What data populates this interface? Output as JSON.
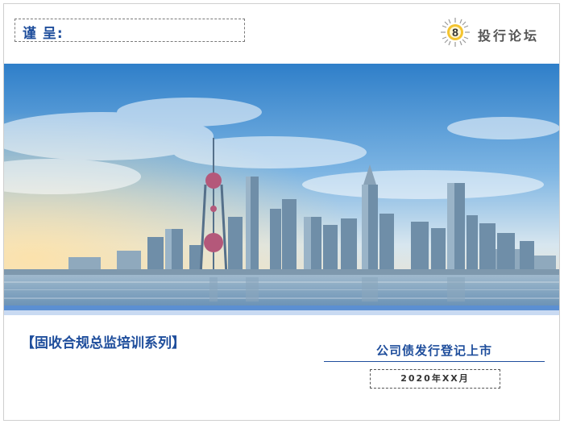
{
  "header": {
    "recipient_label": "谨 呈:",
    "logo_digit": "8",
    "logo_text": "投行论坛"
  },
  "hero": {
    "image_description_icon": "city-skyline-image"
  },
  "footer": {
    "series_title": "【固收合规总监培训系列】",
    "subtitle": "公司债发行登记上市",
    "date": "2020年XX月"
  },
  "colors": {
    "brand_blue": "#1f4e9c",
    "accent_blue": "#5b8fd2",
    "logo_gold": "#d9a21b"
  }
}
